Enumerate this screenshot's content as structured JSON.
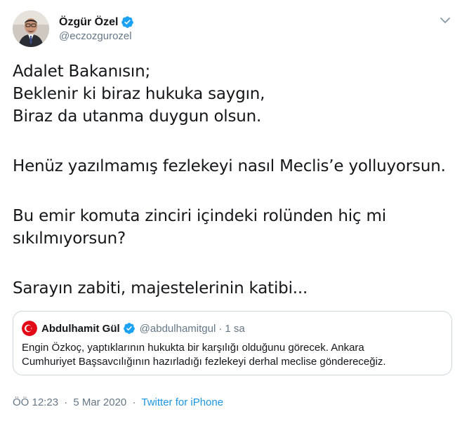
{
  "author": {
    "name": "Özgür Özel",
    "handle": "@eczozgurozel",
    "avatar_icon": "person-avatar-icon",
    "verified_icon": "verified-badge-icon"
  },
  "menu_icon": "chevron-down-icon",
  "tweet": {
    "lines": [
      "Adalet Bakanısın;",
      "Beklenir ki biraz hukuka saygın,",
      "Biraz da utanma duygun olsun.",
      "",
      "Henüz yazılmamış fezlekeyi nasıl Meclis’e yolluyorsun.",
      "",
      "Bu emir komuta zinciri içindeki rolünden hiç mi",
      "sıkılmıyorsun?",
      "",
      "Sarayın zabiti, majestelerinin katibi..."
    ]
  },
  "quote": {
    "name": "Abdulhamit Gül",
    "handle": "@abdulhamitgul",
    "separator": "·",
    "time": "1 sa",
    "avatar_icon": "turkish-flag-avatar-icon",
    "lines": [
      "Engin Özkoç, yaptıklarının hukukta bir karşılığı olduğunu görecek. Ankara",
      "Cumhuriyet Başsavcılığının hazırladığı fezlekeyi derhal meclise göndereceğiz."
    ]
  },
  "meta": {
    "time": "ÖÖ 12:23",
    "separator": "·",
    "date": "5 Mar 2020",
    "separator2": "·",
    "source": "Twitter for iPhone"
  },
  "colors": {
    "link": "#1b95e0",
    "secondary": "#657786",
    "verified": "#1da1f2",
    "border": "#ccd6dd"
  }
}
